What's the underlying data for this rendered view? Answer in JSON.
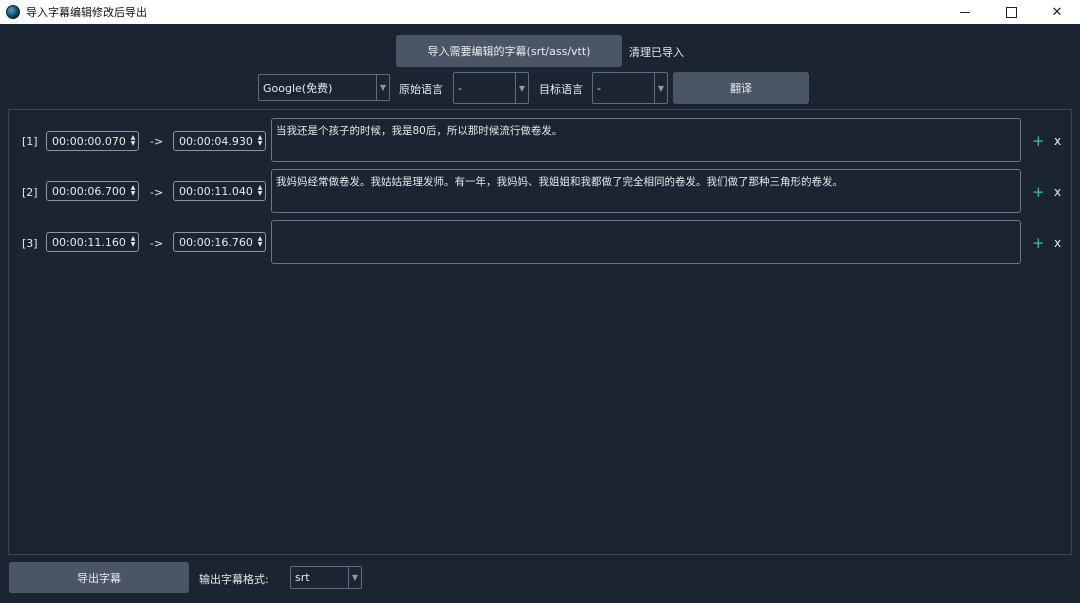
{
  "window": {
    "title": "导入字幕编辑修改后导出"
  },
  "toolbar": {
    "import_label": "导入需要编辑的字幕(srt/ass/vtt)",
    "clear_label": "清理已导入",
    "engine": "Google(免费)",
    "source_lang_label": "原始语言",
    "source_lang_value": "-",
    "target_lang_label": "目标语言",
    "target_lang_value": "-",
    "translate_label": "翻译"
  },
  "rows": [
    {
      "index": "[1]",
      "start": "00:00:00.070",
      "sep": "->",
      "end": "00:00:04.930",
      "text": "当我还是个孩子的时候，我是80后，所以那时候流行做卷发。"
    },
    {
      "index": "[2]",
      "start": "00:00:06.700",
      "sep": "->",
      "end": "00:00:11.040",
      "text": "我妈妈经常做卷发。我姑姑是理发师。有一年，我妈妈、我姐姐和我都做了完全相同的卷发。我们做了那种三角形的卷发。"
    },
    {
      "index": "[3]",
      "start": "00:00:11.160",
      "sep": "->",
      "end": "00:00:16.760",
      "text": ""
    }
  ],
  "row_actions": {
    "add": "+",
    "delete": "x"
  },
  "footer": {
    "export_label": "导出字幕",
    "format_label": "输出字幕格式:",
    "format_value": "srt"
  }
}
